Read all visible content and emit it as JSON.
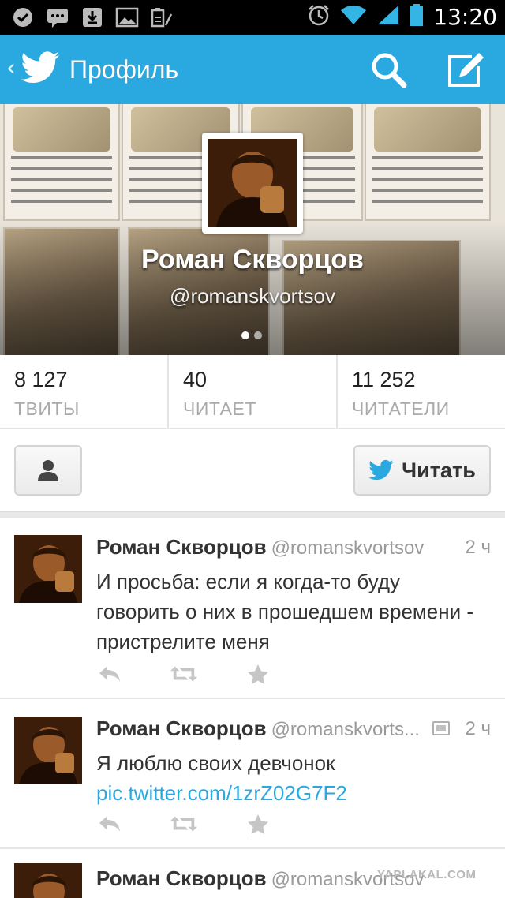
{
  "status_bar": {
    "time": "13:20",
    "left_icons": [
      "check-circle-icon",
      "chat-bubble-icon",
      "download-icon",
      "image-icon",
      "battery-saver-icon"
    ],
    "right_icons": [
      "alarm-icon",
      "wifi-icon",
      "signal-icon",
      "battery-icon"
    ]
  },
  "action_bar": {
    "back_glyph": "‹",
    "title": "Профиль",
    "color": "#2aa9e0"
  },
  "profile": {
    "name": "Роман Скворцов",
    "handle": "@romanskvortsov",
    "page_indicator": {
      "count": 2,
      "active": 0
    }
  },
  "stats": [
    {
      "value": "8 127",
      "label": "ТВИТЫ"
    },
    {
      "value": "40",
      "label": "ЧИТАЕТ"
    },
    {
      "value": "11 252",
      "label": "ЧИТАТЕЛИ"
    }
  ],
  "follow_button": {
    "label": "Читать"
  },
  "tweets": [
    {
      "name": "Роман Скворцов",
      "handle": "@romanskvortsov",
      "time": "2 ч",
      "text": "И просьба: если я когда-то буду говорить о них в прошедшем времени - пристрелите меня",
      "link": "",
      "has_photo": false
    },
    {
      "name": "Роман Скворцов",
      "handle": "@romanskvorts...",
      "time": "2 ч",
      "text": "Я люблю своих девчонок ",
      "link": "pic.twitter.com/1zrZ02G7F2",
      "has_photo": true
    },
    {
      "name": "Роман Скворцов",
      "handle": "@romanskvortsov",
      "time": "",
      "text": "",
      "link": "",
      "has_photo": false
    }
  ],
  "watermark": "YAPLAKAL.COM"
}
